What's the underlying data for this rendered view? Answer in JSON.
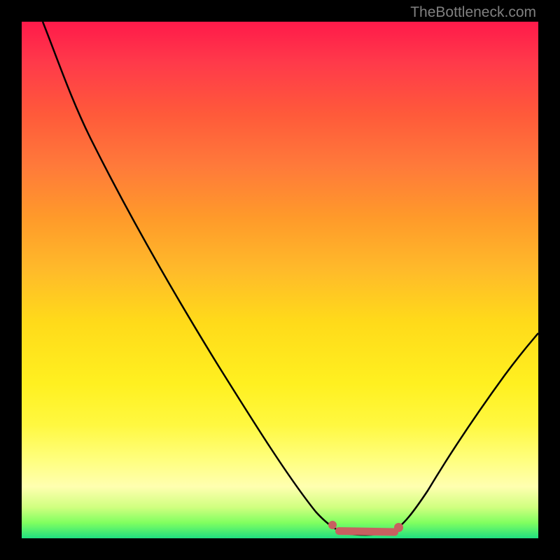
{
  "watermark": "TheBottleneck.com",
  "chart_data": {
    "type": "line",
    "title": "",
    "xlabel": "",
    "ylabel": "",
    "xlim": [
      0,
      100
    ],
    "ylim": [
      0,
      100
    ],
    "background": "gradient-red-yellow-green",
    "series": [
      {
        "name": "bottleneck-curve",
        "color": "#000000",
        "points": [
          {
            "x": 4,
            "y": 100
          },
          {
            "x": 8,
            "y": 92
          },
          {
            "x": 12,
            "y": 82
          },
          {
            "x": 20,
            "y": 67
          },
          {
            "x": 30,
            "y": 49
          },
          {
            "x": 40,
            "y": 32
          },
          {
            "x": 50,
            "y": 16
          },
          {
            "x": 56,
            "y": 6
          },
          {
            "x": 60,
            "y": 1
          },
          {
            "x": 64,
            "y": 0
          },
          {
            "x": 68,
            "y": 0
          },
          {
            "x": 72,
            "y": 0.5
          },
          {
            "x": 76,
            "y": 3
          },
          {
            "x": 80,
            "y": 8
          },
          {
            "x": 86,
            "y": 18
          },
          {
            "x": 92,
            "y": 28
          },
          {
            "x": 100,
            "y": 39
          }
        ]
      }
    ],
    "markers": [
      {
        "type": "dot",
        "x": 60,
        "y": 2,
        "color": "#c86060"
      },
      {
        "type": "segment",
        "x1": 61,
        "y1": 0.5,
        "x2": 74,
        "y2": 1.5,
        "color": "#c86060"
      }
    ]
  }
}
